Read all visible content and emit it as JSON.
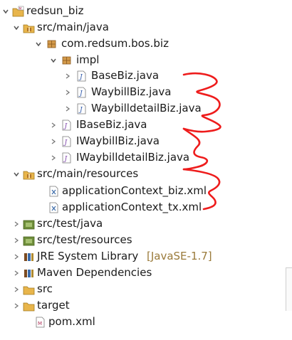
{
  "project": {
    "name": "redsun_biz"
  },
  "folders": {
    "src_main_java": "src/main/java",
    "package_biz": "com.redsum.bos.biz",
    "package_impl": "impl",
    "src_main_resources": "src/main/resources",
    "src_test_java": "src/test/java",
    "src_test_resources": "src/test/resources",
    "jre_label": "JRE System Library",
    "jre_version": "[JavaSE-1.7]",
    "maven_deps": "Maven Dependencies",
    "src": "src",
    "target": "target"
  },
  "files": {
    "base_biz": "BaseBiz.java",
    "waybill_biz": "WaybillBiz.java",
    "waybilldetail_biz": "WaybilldetailBiz.java",
    "ibase_biz": "IBaseBiz.java",
    "iwaybill_biz": "IWaybillBiz.java",
    "iwaybilldetail_biz": "IWaybilldetailBiz.java",
    "app_ctx_biz": "applicationContext_biz.xml",
    "app_ctx_tx": "applicationContext_tx.xml",
    "pom": "pom.xml"
  },
  "icons": {
    "expand": "chevron-down-icon",
    "collapse": "chevron-right-icon",
    "project": "maven-project-icon",
    "source_folder": "source-folder-icon",
    "package": "package-icon",
    "java_class": "java-class-file-icon",
    "java_interface": "java-interface-file-icon",
    "xml_file": "xml-file-icon",
    "library": "library-icon",
    "folder": "folder-icon",
    "pom": "pom-file-icon"
  },
  "colors": {
    "annotation_red": "#ee1c1c",
    "folder": "#e8b54b",
    "package": "#b0742a",
    "java_file": "#2a55a8",
    "library_tone": "#9a7a3a"
  }
}
